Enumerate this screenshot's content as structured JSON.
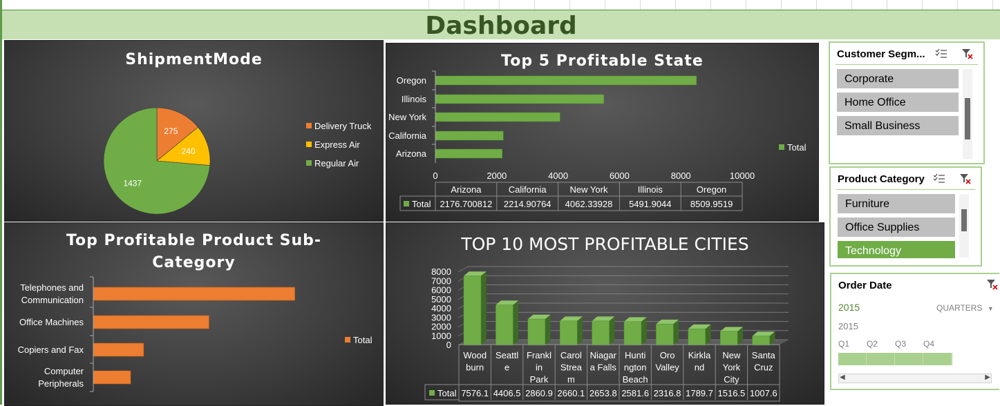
{
  "dashboard": {
    "title": "Dashboard"
  },
  "shipment": {
    "title": "ShipmentMode",
    "chart_data": {
      "type": "pie",
      "title": "ShipmentMode",
      "slices": [
        {
          "name": "Delivery Truck",
          "value": 275,
          "color": "#ed7d31"
        },
        {
          "name": "Express Air",
          "value": 240,
          "color": "#ffc000"
        },
        {
          "name": "Regular Air",
          "value": 1437,
          "color": "#70ad47"
        }
      ],
      "legend": "right"
    }
  },
  "states": {
    "title": "Top 5 Profitable State",
    "legend_label": "Total",
    "chart_data": {
      "type": "bar",
      "orientation": "horizontal",
      "title": "Top 5 Profitable State",
      "categories": [
        "Arizona",
        "California",
        "New York",
        "Illinois",
        "Oregon"
      ],
      "values": [
        2176.700812,
        2214.90764,
        4062.33928,
        5491.9044,
        8509.9519
      ],
      "value_labels": [
        "2176.700812",
        "2214.90764",
        "4062.33928",
        "5491.9044",
        "8509.9519"
      ],
      "xlim": [
        0,
        10000
      ],
      "xticks": [
        "0",
        "2000",
        "4000",
        "6000",
        "8000",
        "10000"
      ],
      "series_name": "Total",
      "color": "#70ad47",
      "legend": "right",
      "data_table": true
    }
  },
  "subcat": {
    "title_line1": "Top Profitable Product Sub-",
    "title_line2": "Category",
    "legend_label": "Total",
    "chart_data": {
      "type": "bar",
      "orientation": "horizontal",
      "title": "Top Profitable Product Sub-Category",
      "categories": [
        [
          "Telephones and",
          "Communication"
        ],
        [
          "Office Machines"
        ],
        [
          "Copiers and Fax"
        ],
        [
          "Computer",
          "Peripherals"
        ]
      ],
      "values": [
        5400,
        3100,
        1350,
        1000
      ],
      "xlim": [
        0,
        6000
      ],
      "series_name": "Total",
      "color": "#ed7d31",
      "legend": "right"
    }
  },
  "cities": {
    "title": "TOP 10 MOST PROFITABLE CITIES",
    "legend_label": "Total",
    "chart_data": {
      "type": "bar",
      "style": "3d-column",
      "title": "TOP 10 MOST PROFITABLE CITIES",
      "categories": [
        [
          "Wood",
          "burn"
        ],
        [
          "Seattl",
          "e"
        ],
        [
          "Frankl",
          "in",
          "Park"
        ],
        [
          "Carol",
          "Strea",
          "m"
        ],
        [
          "Niagar",
          "a Falls"
        ],
        [
          "Hunti",
          "ngton",
          "Beach"
        ],
        [
          "Oro",
          "Valley"
        ],
        [
          "Kirkla",
          "nd"
        ],
        [
          "New",
          "York",
          "City"
        ],
        [
          "Santa",
          "Cruz"
        ]
      ],
      "values": [
        7576.1,
        4406.5,
        2860.9,
        2660.1,
        2653.8,
        2581.6,
        2316.8,
        1789.7,
        1516.5,
        1007.6
      ],
      "value_labels": [
        "7576.1",
        "4406.5",
        "2860.9",
        "2660.1",
        "2653.8",
        "2581.6",
        "2316.8",
        "1789.7",
        "1516.5",
        "1007.6"
      ],
      "ylim": [
        0,
        8000
      ],
      "yticks": [
        "0",
        "1000",
        "2000",
        "3000",
        "4000",
        "5000",
        "6000",
        "7000",
        "8000"
      ],
      "series_name": "Total",
      "color": "#70ad47",
      "data_table": true
    }
  },
  "slicer_segment": {
    "title": "Customer Segm...",
    "items": [
      "Corporate",
      "Home Office",
      "Small Business"
    ],
    "icons": [
      "multi-select-icon",
      "clear-filter-icon"
    ]
  },
  "slicer_category": {
    "title": "Product Category",
    "items": [
      "Furniture",
      "Office Supplies",
      "Technology"
    ],
    "selected": "Technology",
    "icons": [
      "multi-select-icon",
      "clear-filter-icon"
    ]
  },
  "timeline": {
    "title": "Order Date",
    "year": "2015",
    "level": "QUARTERS",
    "scale_year": "2015",
    "quarters": [
      "Q1",
      "Q2",
      "Q3",
      "Q4"
    ],
    "selected_quarters": [
      "Q1",
      "Q2",
      "Q3",
      "Q4"
    ]
  }
}
